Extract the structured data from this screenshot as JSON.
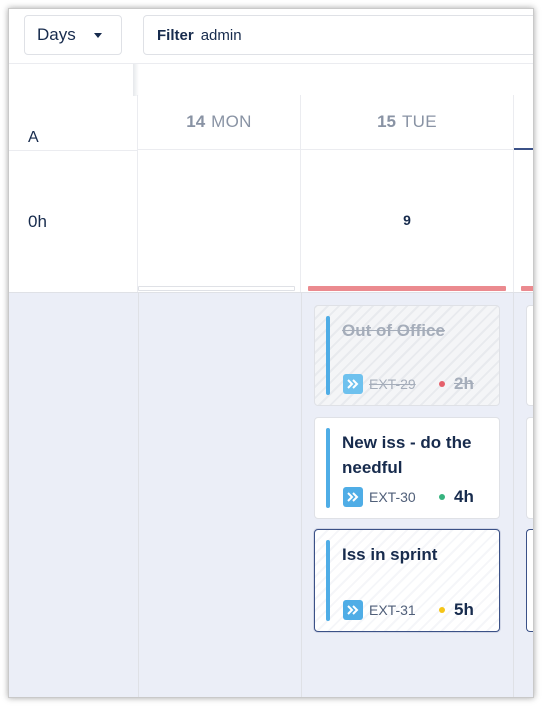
{
  "toolbar": {
    "view_select": {
      "label": "Days"
    },
    "filter": {
      "label": "Filter",
      "value": "admin"
    }
  },
  "left_panel": {
    "header_label": "A",
    "hours": "0h"
  },
  "days": [
    {
      "number": "14",
      "name": "MON",
      "total": ""
    },
    {
      "number": "15",
      "name": "TUE",
      "total": "9"
    }
  ],
  "cards": [
    {
      "title": "Out of Office",
      "key": "EXT-29",
      "hours": "2h",
      "priority_color": "#e5606b",
      "struck": true,
      "selected": false
    },
    {
      "title": "New iss - do the needful",
      "key": "EXT-30",
      "hours": "4h",
      "priority_color": "#36b37e",
      "struck": false,
      "selected": false
    },
    {
      "title": "Iss in sprint",
      "key": "EXT-31",
      "hours": "5h",
      "priority_color": "#f5c518",
      "struck": false,
      "selected": true
    }
  ],
  "colors": {
    "capacity_over": "#eb8a8f",
    "capacity_empty": "#ffffff",
    "story_icon": "#4fade6",
    "selected_border": "#3b5187",
    "body_background": "#ebeef7"
  },
  "icons": {
    "view_caret": "caret-down-icon",
    "issue_type": "chevron-double-right-icon"
  }
}
